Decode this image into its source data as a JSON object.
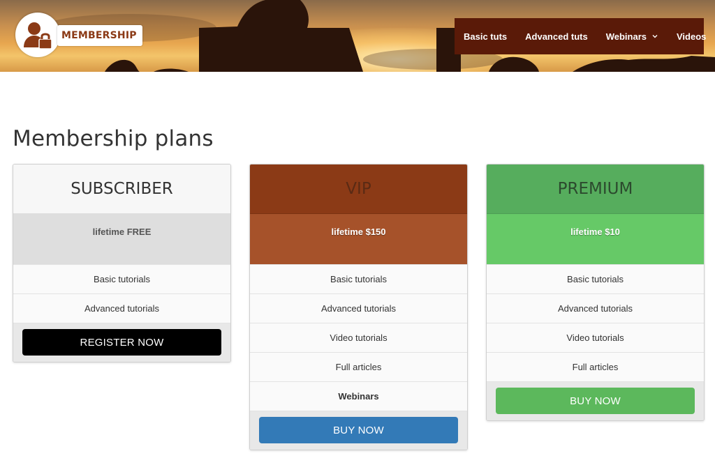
{
  "brand": {
    "logo_text": "MEMBERSHIP"
  },
  "nav": {
    "items": [
      {
        "label": "Basic tuts"
      },
      {
        "label": "Advanced tuts"
      },
      {
        "label": "Webinars",
        "has_dropdown": true
      },
      {
        "label": "Videos"
      }
    ]
  },
  "page": {
    "title": "Membership plans"
  },
  "plans": [
    {
      "name": "SUBSCRIBER",
      "price": "lifetime FREE",
      "features": [
        "Basic tutorials",
        "Advanced tutorials"
      ],
      "button": "REGISTER NOW",
      "colors": {
        "header": "#f7f7f7",
        "price": "#dedede",
        "button": "#000000"
      }
    },
    {
      "name": "VIP",
      "price": "lifetime $150",
      "features": [
        "Basic tutorials",
        "Advanced tutorials",
        "Video tutorials",
        "Full articles",
        "Webinars"
      ],
      "button": "BUY NOW",
      "colors": {
        "header": "#8b3a16",
        "price": "#a6522a",
        "button": "#337ab7"
      }
    },
    {
      "name": "PREMIUM",
      "price": "lifetime $10",
      "features": [
        "Basic tutorials",
        "Advanced tutorials",
        "Video tutorials",
        "Full articles"
      ],
      "button": "BUY NOW",
      "colors": {
        "header": "#56ad5d",
        "price": "#66c967",
        "button": "#5cb85c"
      }
    }
  ],
  "colors": {
    "nav_bg": "#5a1a08",
    "brand": "#8b3a16"
  },
  "icons": {
    "logo": "user-lock-icon",
    "dropdown": "chevron-down-icon"
  }
}
